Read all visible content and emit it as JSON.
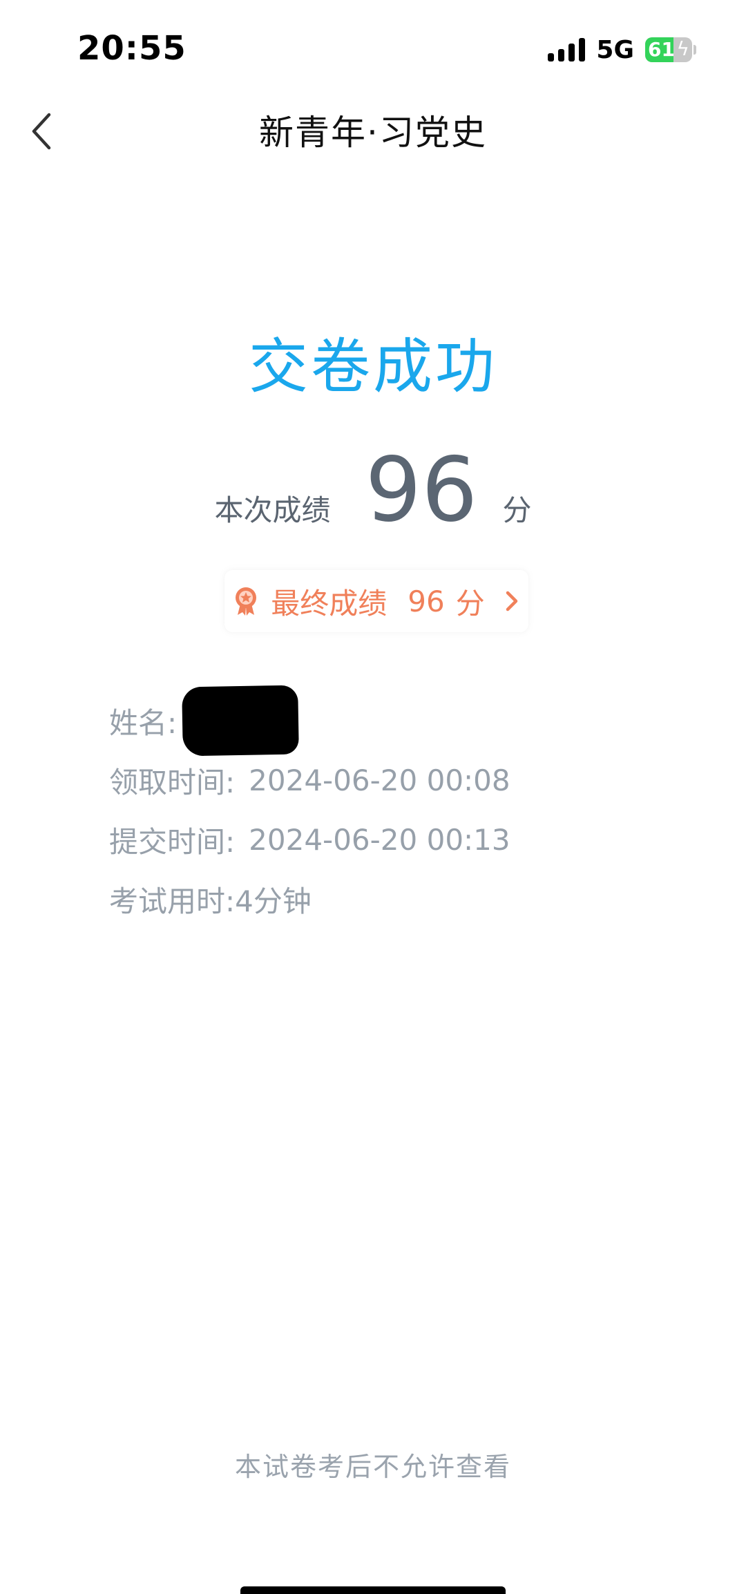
{
  "status_bar": {
    "time": "20:55",
    "network": "5G",
    "battery_level": "61",
    "battery_fraction": 0.61,
    "icons": [
      "signal-icon",
      "battery-icon",
      "charging-bolt-icon"
    ]
  },
  "nav": {
    "title": "新青年·习党史",
    "back_icon": "chevron-left-icon"
  },
  "result": {
    "title": "交卷成功",
    "score_label": "本次成绩",
    "score_value": "96",
    "score_unit": "分"
  },
  "final_score": {
    "label": "最终成绩",
    "value": "96",
    "unit": "分",
    "icon": "medal-icon",
    "chevron_icon": "chevron-right-icon"
  },
  "info": {
    "name_label": "姓名:",
    "receive_label": "领取时间:",
    "receive_value": "2024-06-20 00:08",
    "submit_label": "提交时间:",
    "submit_value": "2024-06-20 00:13",
    "duration_label": "考试用时:",
    "duration_value": "4分钟"
  },
  "footer": {
    "note": "本试卷考后不允许查看"
  },
  "colors": {
    "accent_blue": "#1aa7ec",
    "final_orange": "#f0805a",
    "muted_gray": "#97a0aa",
    "score_gray": "#5b6673",
    "battery_green": "#33d35a"
  }
}
